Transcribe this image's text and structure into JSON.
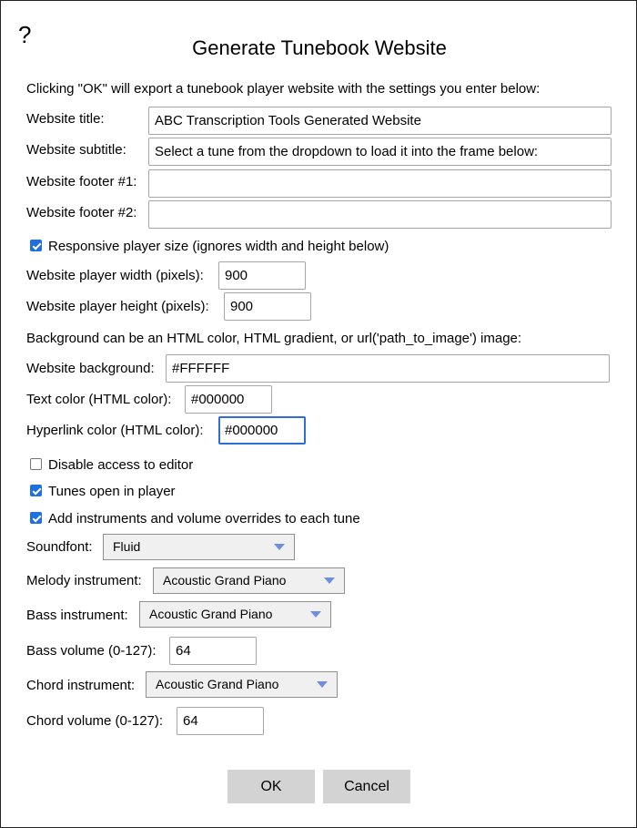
{
  "dialog": {
    "help_icon": "?",
    "title": "Generate Tunebook Website",
    "intro": "Clicking \"OK\" will export a tunebook player website with the settings you enter below:"
  },
  "fields": {
    "website_title": {
      "label": "Website title:",
      "value": "ABC Transcription Tools Generated Website"
    },
    "website_subtitle": {
      "label": "Website subtitle:",
      "value": "Select a tune from the dropdown to load it into the frame below:"
    },
    "footer1": {
      "label": "Website footer #1:",
      "value": ""
    },
    "footer2": {
      "label": "Website footer #2:",
      "value": ""
    },
    "responsive": {
      "label": "Responsive player size (ignores width and height below)",
      "checked": true
    },
    "player_width": {
      "label": "Website player width (pixels):",
      "value": "900"
    },
    "player_height": {
      "label": "Website player height (pixels):",
      "value": "900"
    },
    "background_note": "Background can be an HTML color, HTML gradient, or url('path_to_image') image:",
    "background": {
      "label": "Website background:",
      "value": "#FFFFFF"
    },
    "text_color": {
      "label": "Text color (HTML color):",
      "value": "#000000"
    },
    "hyperlink_color": {
      "label": "Hyperlink color (HTML color):",
      "value": "#000000"
    },
    "disable_editor": {
      "label": "Disable access to editor",
      "checked": false
    },
    "open_in_player": {
      "label": "Tunes open in player",
      "checked": true
    },
    "add_instruments": {
      "label": "Add instruments and volume overrides to each tune",
      "checked": true
    },
    "soundfont": {
      "label": "Soundfont:",
      "selected": "Fluid"
    },
    "melody_instrument": {
      "label": "Melody instrument:",
      "selected": "Acoustic Grand Piano"
    },
    "bass_instrument": {
      "label": "Bass instrument:",
      "selected": "Acoustic Grand Piano"
    },
    "bass_volume": {
      "label": "Bass volume (0-127):",
      "value": "64"
    },
    "chord_instrument": {
      "label": "Chord instrument:",
      "selected": "Acoustic Grand Piano"
    },
    "chord_volume": {
      "label": "Chord volume (0-127):",
      "value": "64"
    }
  },
  "buttons": {
    "ok": "OK",
    "cancel": "Cancel"
  },
  "colors": {
    "checkbox_accent": "#1f6fe0",
    "focus_ring": "#2e6fd6",
    "dropdown_arrow": "#6f8fde",
    "button_bg": "#d3d3d3"
  }
}
